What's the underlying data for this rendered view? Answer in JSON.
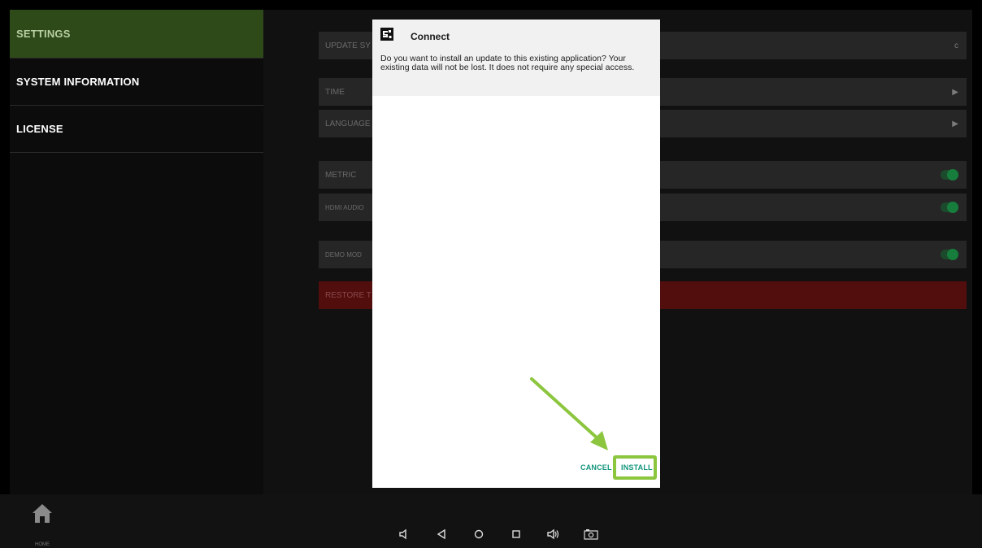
{
  "sidebar": {
    "items": [
      {
        "label": "SETTINGS"
      },
      {
        "label": "SYSTEM INFORMATION"
      },
      {
        "label": "LICENSE"
      }
    ]
  },
  "settings": {
    "update_system": "UPDATE SY",
    "time": "TIME",
    "language": "LANGUAGE",
    "metric": "METRIC",
    "hdmi_audio": "HDMI AUDIO",
    "demo_mode": "DEMO MOD",
    "restore": "RESTORE T",
    "refresh_icon": "c",
    "arrow_icon": "▶",
    "toggles_on": true
  },
  "dialog": {
    "title": "Connect",
    "message": "Do you want to install an update to this existing application? Your existing data will not be lost. It does not require any special access.",
    "cancel_label": "CANCEL",
    "install_label": "INSTALL"
  },
  "bottom": {
    "home_label": "HOME",
    "nav_icons": [
      "volume-down-icon",
      "back-icon",
      "home-circle-icon",
      "recents-icon",
      "volume-up-icon",
      "screenshot-icon"
    ]
  },
  "colors": {
    "accent_green": "#8cc63f",
    "button_teal": "#13957c",
    "restore_red": "#520d0d",
    "active_sidebar": "#2f4a19"
  }
}
